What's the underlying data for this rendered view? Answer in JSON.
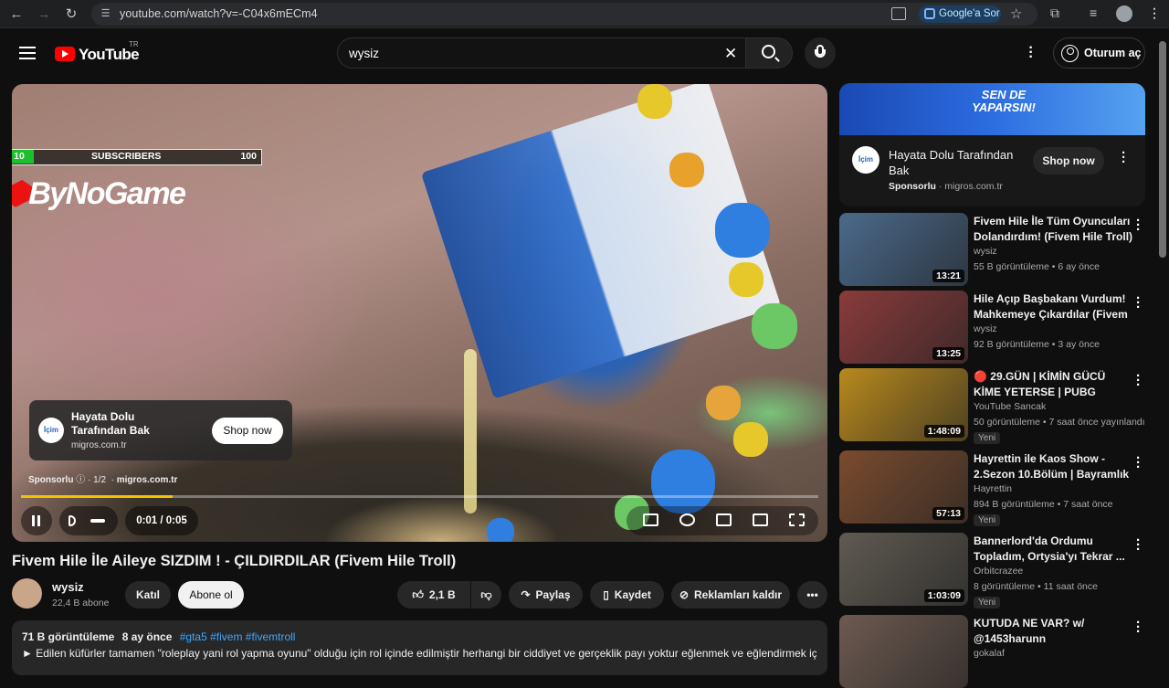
{
  "browser": {
    "url": "youtube.com/watch?v=-C04x6mECm4",
    "google_ask": "Google'a Sor"
  },
  "header": {
    "logo_text": "YouTube",
    "region": "TR",
    "search_value": "wysiz",
    "signin": "Oturum aç"
  },
  "player": {
    "overlay": {
      "sub_start": "10",
      "sub_label": "SUBSCRIBERS",
      "sub_goal": "100",
      "brand": "ByNoGame"
    },
    "ad": {
      "title": "Hayata Dolu Tarafından Bak",
      "domain": "migros.com.tr",
      "cta": "Shop now",
      "sponsor_label": "Sponsorlu",
      "ad_index": "1/2"
    },
    "progress": 0.19,
    "time": "0:01 / 0:05"
  },
  "video": {
    "title": "Fivem Hile İle Aileye SIZDIM ! - ÇILDIRDILAR (Fivem Hile Troll)",
    "channel": "wysiz",
    "subscribers": "22,4 B abone",
    "join": "Katıl",
    "subscribe": "Abone ol",
    "likes": "2,1 B",
    "share": "Paylaş",
    "save": "Kaydet",
    "remove_ads": "Reklamları kaldır",
    "views": "71 B görüntüleme",
    "age": "8 ay önce",
    "tags": "#gta5 #fivem #fivemtroll",
    "description": "► Edilen küfürler tamamen \"roleplay yani rol yapma oyunu\" olduğu için rol içinde edilmiştir herhangi bir ciddiyet ve gerçeklik payı yoktur eğlenmek ve eğlendirmek için"
  },
  "sidebar_ad": {
    "banner_text": "SEN DE YAPARSIN!",
    "title": "Hayata Dolu Tarafından Bak",
    "sponsor": "Sponsorlu",
    "domain": "migros.com.tr",
    "cta": "Shop now"
  },
  "recommendations": [
    {
      "title": "Fivem Hile İle Tüm Oyuncuları Dolandırdım! (Fivem Hile Troll)",
      "channel": "wysiz",
      "meta": "55 B görüntüleme • 6 ay önce",
      "duration": "13:21",
      "badge": "",
      "color": "#4a6a8c"
    },
    {
      "title": "Hile Açıp Başbakanı Vurdum! Mahkemeye Çıkardılar (Fivem ...",
      "channel": "wysiz",
      "meta": "92 B görüntüleme • 3 ay önce",
      "duration": "13:25",
      "badge": "",
      "color": "#8a3b3b"
    },
    {
      "title": "🔴 29.GÜN | KİMİN GÜCÜ KİME YETERSE | PUBG MOBIL",
      "channel": "YouTube Sancak",
      "meta": "50 görüntüleme • 7 saat önce yayınlandı",
      "duration": "1:48:09",
      "badge": "Yeni",
      "color": "#b88a1e"
    },
    {
      "title": "Hayrettin ile Kaos Show - 2.Sezon 10.Bölüm | Bayramlık ...",
      "channel": "Hayrettin",
      "meta": "894 B görüntüleme • 7 saat önce",
      "duration": "57:13",
      "badge": "Yeni",
      "color": "#7a4b2e"
    },
    {
      "title": "Bannerlord'da Ordumu Topladım, Ortysia'yı Tekrar ...",
      "channel": "Orbitcrazee",
      "meta": "8 görüntüleme • 11 saat önce",
      "duration": "1:03:09",
      "badge": "Yeni",
      "color": "#5f5a52"
    },
    {
      "title": "KUTUDA NE VAR? w/ @1453harunn",
      "channel": "gokalaf",
      "meta": "",
      "duration": "",
      "badge": "",
      "color": "#6d5a50"
    }
  ]
}
